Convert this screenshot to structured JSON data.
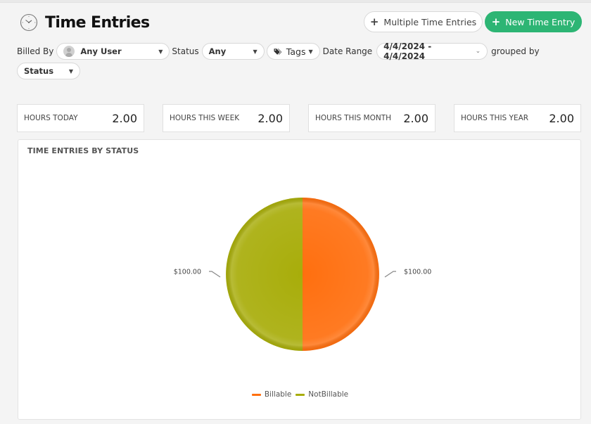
{
  "header": {
    "title": "Time Entries",
    "icon": "clock-icon"
  },
  "actions": {
    "multiple_label": "Multiple Time Entries",
    "new_label": "New Time Entry",
    "new_color": "#2db574"
  },
  "filters": {
    "billed_by_label": "Billed By",
    "billed_by_value": "Any User",
    "status_label": "Status",
    "status_value": "Any",
    "tags_label": "Tags",
    "date_range_label": "Date Range",
    "date_range_value": "4/4/2024 - 4/4/2024",
    "grouped_by_label": "grouped by",
    "grouped_by_value": "Status"
  },
  "stats": [
    {
      "label": "Hours Today",
      "value": "2.00"
    },
    {
      "label": "Hours This Week",
      "value": "2.00"
    },
    {
      "label": "Hours This Month",
      "value": "2.00"
    },
    {
      "label": "Hours This Year",
      "value": "2.00"
    }
  ],
  "chart_card": {
    "title": "Time Entries By Status"
  },
  "chart_data": {
    "type": "pie",
    "title": "Time Entries By Status",
    "slices": [
      {
        "label": "Billable",
        "value": 100.0,
        "display": "$100.00",
        "color": "#ff6f0f"
      },
      {
        "label": "NotBillable",
        "value": 100.0,
        "display": "$100.00",
        "color": "#a8ad0a"
      }
    ],
    "legend": [
      "Billable",
      "NotBillable"
    ],
    "legend_position": "bottom"
  }
}
